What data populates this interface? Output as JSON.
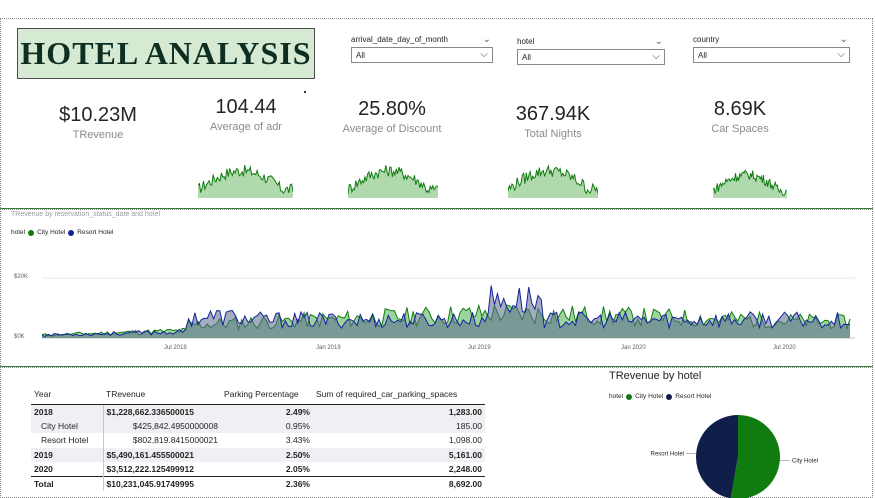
{
  "header": {
    "title": "HOTEL ANALYSIS"
  },
  "slicers": [
    {
      "label": "arrival_date_day_of_month",
      "value": "All"
    },
    {
      "label": "hotel",
      "value": "All"
    },
    {
      "label": "country",
      "value": "All"
    }
  ],
  "kpis": [
    {
      "value": "$10.23M",
      "label": "TRevenue"
    },
    {
      "value": "104.44",
      "label": "Average of adr"
    },
    {
      "value": "25.80%",
      "label": "Average of Discount"
    },
    {
      "value": "367.94K",
      "label": "Total Nights"
    },
    {
      "value": "8.69K",
      "label": "Car Spaces"
    }
  ],
  "line_chart": {
    "title": "TRevenue by reservation_status_date and hotel",
    "legend_title": "hotel",
    "series_names": [
      "City Hotel",
      "Resort Hotel"
    ],
    "y_ticks": [
      "$20K",
      "$0K"
    ],
    "x_ticks": [
      "Jul 2018",
      "Jan 2019",
      "Jul 2019",
      "Jan 2020",
      "Jul 2020"
    ],
    "colors": {
      "city": "#107c10",
      "resort": "#12239e"
    }
  },
  "table": {
    "headers": [
      "Year",
      "TRevenue",
      "Parking Percentage",
      "Sum of required_car_parking_spaces"
    ],
    "rows": [
      {
        "year": "2018",
        "revenue": "$1,228,662.336500015",
        "parking": "2.49%",
        "spaces": "1,283.00",
        "style": "bold shade"
      },
      {
        "year": "City Hotel",
        "revenue": "$425,842.4950000008",
        "parking": "0.95%",
        "spaces": "185.00",
        "style": "child shade"
      },
      {
        "year": "Resort Hotel",
        "revenue": "$802,819.8415000021",
        "parking": "3.43%",
        "spaces": "1,098.00",
        "style": "child2"
      },
      {
        "year": "2019",
        "revenue": "$5,490,161.455500021",
        "parking": "2.50%",
        "spaces": "5,161.00",
        "style": "bold shade"
      },
      {
        "year": "2020",
        "revenue": "$3,512,222.125499912",
        "parking": "2.05%",
        "spaces": "2,248.00",
        "style": "bold"
      },
      {
        "year": "Total",
        "revenue": "$10,231,045.91749995",
        "parking": "2.36%",
        "spaces": "8,692.00",
        "style": "total"
      }
    ]
  },
  "pie_chart": {
    "title": "TRevenue by hotel",
    "legend_title": "hotel",
    "labels": [
      "City Hotel",
      "Resort Hotel"
    ]
  },
  "chart_data": [
    {
      "type": "pie",
      "title": "TRevenue by hotel",
      "categories": [
        "City Hotel",
        "Resort Hotel"
      ],
      "values": [
        5.4,
        4.83
      ],
      "colors": [
        "#107c10",
        "#0f1f4a"
      ]
    }
  ]
}
